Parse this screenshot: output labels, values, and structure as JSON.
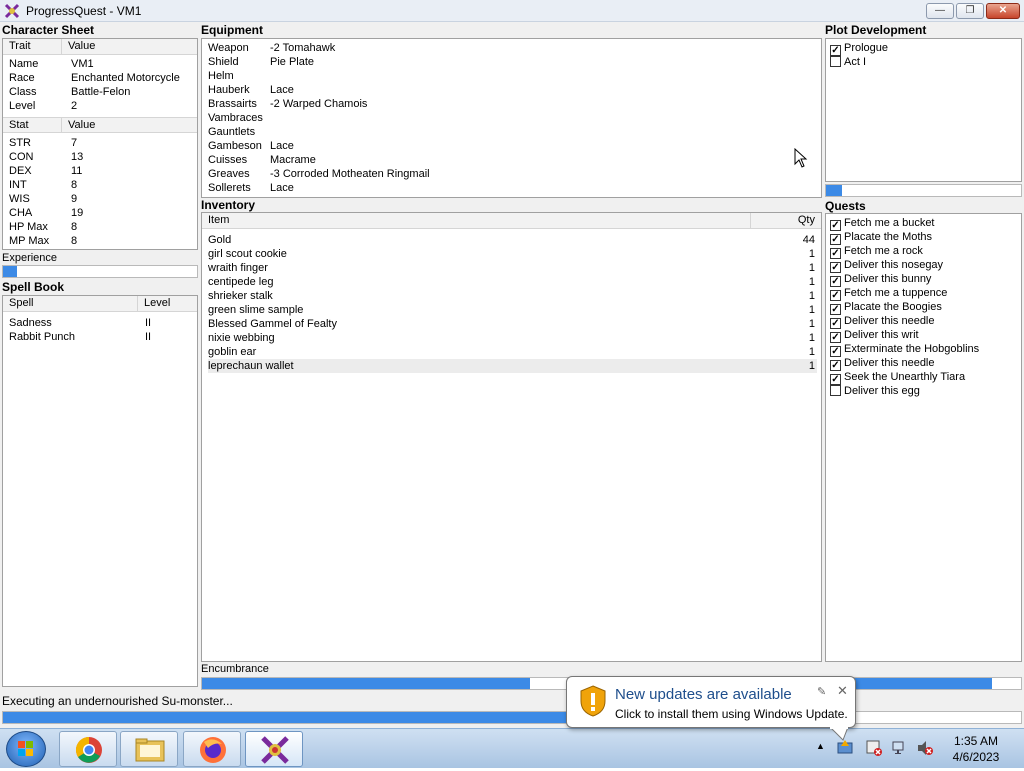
{
  "window": {
    "title": "ProgressQuest - VM1"
  },
  "character_sheet": {
    "title": "Character Sheet",
    "columns": [
      "Trait",
      "Value"
    ],
    "traits": [
      {
        "k": "Name",
        "v": "VM1"
      },
      {
        "k": "Race",
        "v": "Enchanted Motorcycle"
      },
      {
        "k": "Class",
        "v": "Battle-Felon"
      },
      {
        "k": "Level",
        "v": "2"
      }
    ],
    "stat_columns": [
      "Stat",
      "Value"
    ],
    "stats": [
      {
        "k": "STR",
        "v": "7"
      },
      {
        "k": "CON",
        "v": "13"
      },
      {
        "k": "DEX",
        "v": "11"
      },
      {
        "k": "INT",
        "v": "8"
      },
      {
        "k": "WIS",
        "v": "9"
      },
      {
        "k": "CHA",
        "v": "19"
      },
      {
        "k": "HP Max",
        "v": "8"
      },
      {
        "k": "MP Max",
        "v": "8"
      }
    ],
    "experience_label": "Experience",
    "experience_progress": 0.07
  },
  "spell_book": {
    "title": "Spell Book",
    "columns": [
      "Spell",
      "Level"
    ],
    "spells": [
      {
        "k": "Sadness",
        "v": "II"
      },
      {
        "k": "Rabbit Punch",
        "v": "II"
      }
    ]
  },
  "equipment": {
    "title": "Equipment",
    "items": [
      {
        "k": "Weapon",
        "v": "-2 Tomahawk"
      },
      {
        "k": "Shield",
        "v": "Pie Plate"
      },
      {
        "k": "Helm",
        "v": ""
      },
      {
        "k": "Hauberk",
        "v": "Lace"
      },
      {
        "k": "Brassairts",
        "v": "-2 Warped Chamois"
      },
      {
        "k": "Vambraces",
        "v": ""
      },
      {
        "k": "Gauntlets",
        "v": ""
      },
      {
        "k": "Gambeson",
        "v": "Lace"
      },
      {
        "k": "Cuisses",
        "v": "Macrame"
      },
      {
        "k": "Greaves",
        "v": "-3 Corroded Motheaten Ringmail"
      },
      {
        "k": "Sollerets",
        "v": "Lace"
      }
    ]
  },
  "inventory": {
    "title": "Inventory",
    "columns": [
      "Item",
      "Qty"
    ],
    "items": [
      {
        "k": "Gold",
        "q": "44"
      },
      {
        "k": "girl scout cookie",
        "q": "1"
      },
      {
        "k": "wraith finger",
        "q": "1"
      },
      {
        "k": "centipede leg",
        "q": "1"
      },
      {
        "k": "shrieker stalk",
        "q": "1"
      },
      {
        "k": "green slime sample",
        "q": "1"
      },
      {
        "k": "Blessed Gammel of Fealty",
        "q": "1"
      },
      {
        "k": "nixie webbing",
        "q": "1"
      },
      {
        "k": "goblin ear",
        "q": "1"
      },
      {
        "k": "leprechaun wallet",
        "q": "1"
      }
    ],
    "encumbrance_label": "Encumbrance",
    "encumbrance_progress": 0.53
  },
  "plot": {
    "title": "Plot Development",
    "acts": [
      {
        "label": "Prologue",
        "done": true
      },
      {
        "label": "Act I",
        "done": false
      }
    ],
    "progress": 0.08
  },
  "quests": {
    "title": "Quests",
    "items": [
      {
        "label": "Fetch me a bucket",
        "done": true
      },
      {
        "label": "Placate the Moths",
        "done": true
      },
      {
        "label": "Fetch me a rock",
        "done": true
      },
      {
        "label": "Deliver this nosegay",
        "done": true
      },
      {
        "label": "Deliver this bunny",
        "done": true
      },
      {
        "label": "Fetch me a tuppence",
        "done": true
      },
      {
        "label": "Placate the Boogies",
        "done": true
      },
      {
        "label": "Deliver this needle",
        "done": true
      },
      {
        "label": "Deliver this writ",
        "done": true
      },
      {
        "label": "Exterminate the Hobgoblins",
        "done": true
      },
      {
        "label": "Deliver this needle",
        "done": true
      },
      {
        "label": "Seek the Unearthly Tiara",
        "done": true
      },
      {
        "label": "Deliver this egg",
        "done": false
      }
    ],
    "progress": 0.85
  },
  "status": {
    "text": "Executing an undernourished Su-monster...",
    "progress": 0.62
  },
  "notification": {
    "title": "New updates are available",
    "subtitle": "Click to install them using Windows Update."
  },
  "clock": {
    "time": "1:35 AM",
    "date": "4/6/2023"
  },
  "colors": {
    "progress": "#3c8ae6"
  }
}
